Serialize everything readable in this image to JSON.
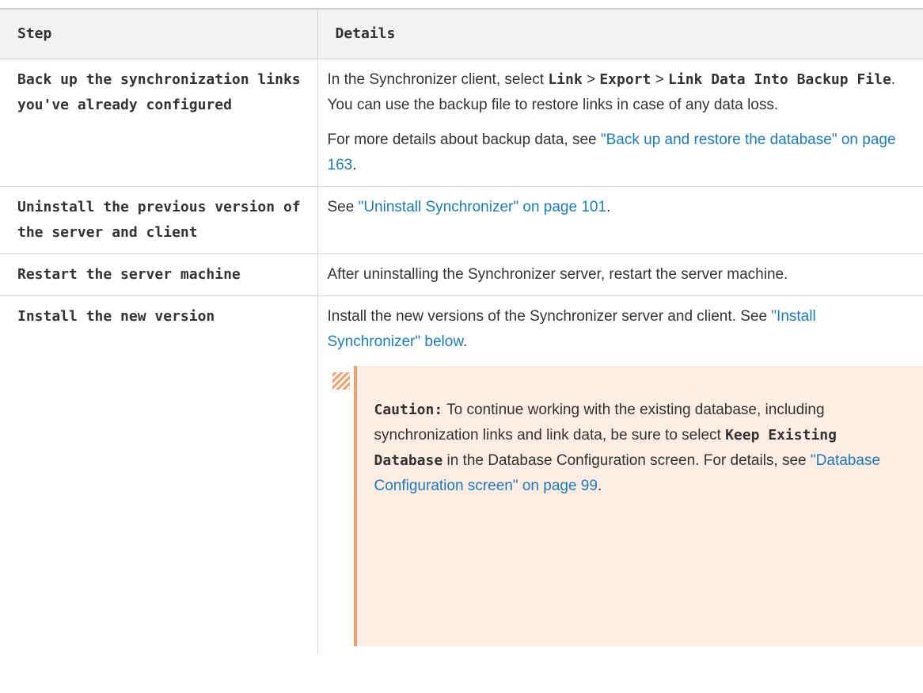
{
  "table": {
    "headers": {
      "step": "Step",
      "details": "Details"
    },
    "rows": [
      {
        "step": "Back up the synchronization links you've already configured",
        "details": {
          "p1_prefix": "In the Synchronizer client, select ",
          "kw_link": "Link",
          "sep1": " > ",
          "kw_export": "Export",
          "sep2": " > ",
          "kw_link_data": "Link Data Into Backup File",
          "p1_suffix": ". You can use the backup file to restore links in case of any data loss.",
          "p2_prefix": "For more details about backup data, see ",
          "p2_link": "\"Back up and restore the database\" on page 163",
          "p2_suffix": "."
        }
      },
      {
        "step": "Uninstall the previous version of the server and client",
        "details": {
          "prefix": "See ",
          "link": "\"Uninstall Synchronizer\" on page 101",
          "suffix": "."
        }
      },
      {
        "step": "Restart the server machine",
        "details": {
          "text": "After uninstalling the Synchronizer server, restart the server machine."
        }
      },
      {
        "step": "Install the new version",
        "details": {
          "p1_prefix": "Install the new versions of the Synchronizer server and client. See ",
          "p1_link": "\"Install Synchronizer\" below",
          "p1_suffix": ".",
          "caution": {
            "label": "Caution:",
            "text1": " To continue working with the existing database, including synchronization links and link data, be sure to select ",
            "kw": "Keep Existing Database",
            "text2": " in the Database Configuration screen. For details, see ",
            "link": "\"Database Configuration screen\" on page 99",
            "suffix": "."
          }
        }
      }
    ]
  },
  "colors": {
    "link": "#1f7bb6",
    "header_bg": "#f2f2f2",
    "caution_bg": "#fdece3",
    "caution_bar": "#f0a06e"
  },
  "icons": {
    "caution": "striped-caution-icon"
  }
}
